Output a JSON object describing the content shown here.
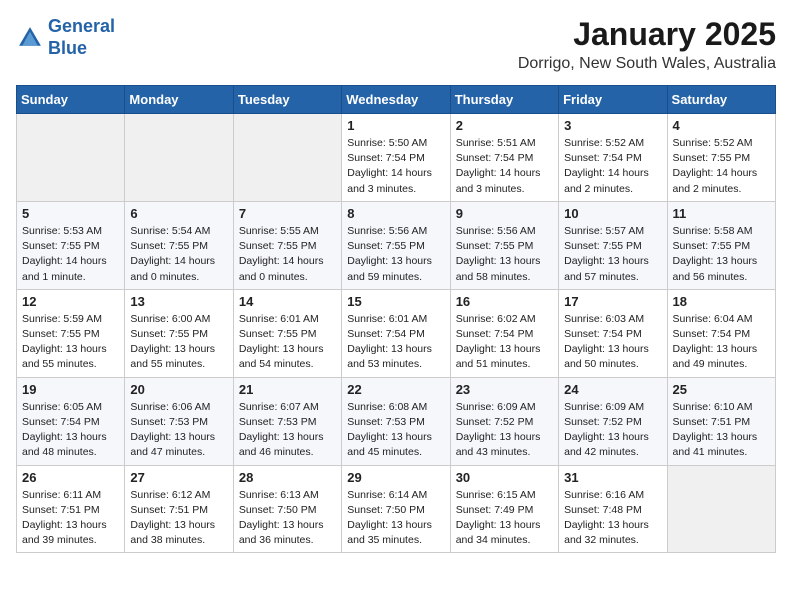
{
  "header": {
    "logo_line1": "General",
    "logo_line2": "Blue",
    "title": "January 2025",
    "subtitle": "Dorrigo, New South Wales, Australia"
  },
  "weekdays": [
    "Sunday",
    "Monday",
    "Tuesday",
    "Wednesday",
    "Thursday",
    "Friday",
    "Saturday"
  ],
  "weeks": [
    [
      {
        "day": "",
        "info": ""
      },
      {
        "day": "",
        "info": ""
      },
      {
        "day": "",
        "info": ""
      },
      {
        "day": "1",
        "info": "Sunrise: 5:50 AM\nSunset: 7:54 PM\nDaylight: 14 hours\nand 3 minutes."
      },
      {
        "day": "2",
        "info": "Sunrise: 5:51 AM\nSunset: 7:54 PM\nDaylight: 14 hours\nand 3 minutes."
      },
      {
        "day": "3",
        "info": "Sunrise: 5:52 AM\nSunset: 7:54 PM\nDaylight: 14 hours\nand 2 minutes."
      },
      {
        "day": "4",
        "info": "Sunrise: 5:52 AM\nSunset: 7:55 PM\nDaylight: 14 hours\nand 2 minutes."
      }
    ],
    [
      {
        "day": "5",
        "info": "Sunrise: 5:53 AM\nSunset: 7:55 PM\nDaylight: 14 hours\nand 1 minute."
      },
      {
        "day": "6",
        "info": "Sunrise: 5:54 AM\nSunset: 7:55 PM\nDaylight: 14 hours\nand 0 minutes."
      },
      {
        "day": "7",
        "info": "Sunrise: 5:55 AM\nSunset: 7:55 PM\nDaylight: 14 hours\nand 0 minutes."
      },
      {
        "day": "8",
        "info": "Sunrise: 5:56 AM\nSunset: 7:55 PM\nDaylight: 13 hours\nand 59 minutes."
      },
      {
        "day": "9",
        "info": "Sunrise: 5:56 AM\nSunset: 7:55 PM\nDaylight: 13 hours\nand 58 minutes."
      },
      {
        "day": "10",
        "info": "Sunrise: 5:57 AM\nSunset: 7:55 PM\nDaylight: 13 hours\nand 57 minutes."
      },
      {
        "day": "11",
        "info": "Sunrise: 5:58 AM\nSunset: 7:55 PM\nDaylight: 13 hours\nand 56 minutes."
      }
    ],
    [
      {
        "day": "12",
        "info": "Sunrise: 5:59 AM\nSunset: 7:55 PM\nDaylight: 13 hours\nand 55 minutes."
      },
      {
        "day": "13",
        "info": "Sunrise: 6:00 AM\nSunset: 7:55 PM\nDaylight: 13 hours\nand 55 minutes."
      },
      {
        "day": "14",
        "info": "Sunrise: 6:01 AM\nSunset: 7:55 PM\nDaylight: 13 hours\nand 54 minutes."
      },
      {
        "day": "15",
        "info": "Sunrise: 6:01 AM\nSunset: 7:54 PM\nDaylight: 13 hours\nand 53 minutes."
      },
      {
        "day": "16",
        "info": "Sunrise: 6:02 AM\nSunset: 7:54 PM\nDaylight: 13 hours\nand 51 minutes."
      },
      {
        "day": "17",
        "info": "Sunrise: 6:03 AM\nSunset: 7:54 PM\nDaylight: 13 hours\nand 50 minutes."
      },
      {
        "day": "18",
        "info": "Sunrise: 6:04 AM\nSunset: 7:54 PM\nDaylight: 13 hours\nand 49 minutes."
      }
    ],
    [
      {
        "day": "19",
        "info": "Sunrise: 6:05 AM\nSunset: 7:54 PM\nDaylight: 13 hours\nand 48 minutes."
      },
      {
        "day": "20",
        "info": "Sunrise: 6:06 AM\nSunset: 7:53 PM\nDaylight: 13 hours\nand 47 minutes."
      },
      {
        "day": "21",
        "info": "Sunrise: 6:07 AM\nSunset: 7:53 PM\nDaylight: 13 hours\nand 46 minutes."
      },
      {
        "day": "22",
        "info": "Sunrise: 6:08 AM\nSunset: 7:53 PM\nDaylight: 13 hours\nand 45 minutes."
      },
      {
        "day": "23",
        "info": "Sunrise: 6:09 AM\nSunset: 7:52 PM\nDaylight: 13 hours\nand 43 minutes."
      },
      {
        "day": "24",
        "info": "Sunrise: 6:09 AM\nSunset: 7:52 PM\nDaylight: 13 hours\nand 42 minutes."
      },
      {
        "day": "25",
        "info": "Sunrise: 6:10 AM\nSunset: 7:51 PM\nDaylight: 13 hours\nand 41 minutes."
      }
    ],
    [
      {
        "day": "26",
        "info": "Sunrise: 6:11 AM\nSunset: 7:51 PM\nDaylight: 13 hours\nand 39 minutes."
      },
      {
        "day": "27",
        "info": "Sunrise: 6:12 AM\nSunset: 7:51 PM\nDaylight: 13 hours\nand 38 minutes."
      },
      {
        "day": "28",
        "info": "Sunrise: 6:13 AM\nSunset: 7:50 PM\nDaylight: 13 hours\nand 36 minutes."
      },
      {
        "day": "29",
        "info": "Sunrise: 6:14 AM\nSunset: 7:50 PM\nDaylight: 13 hours\nand 35 minutes."
      },
      {
        "day": "30",
        "info": "Sunrise: 6:15 AM\nSunset: 7:49 PM\nDaylight: 13 hours\nand 34 minutes."
      },
      {
        "day": "31",
        "info": "Sunrise: 6:16 AM\nSunset: 7:48 PM\nDaylight: 13 hours\nand 32 minutes."
      },
      {
        "day": "",
        "info": ""
      }
    ]
  ]
}
